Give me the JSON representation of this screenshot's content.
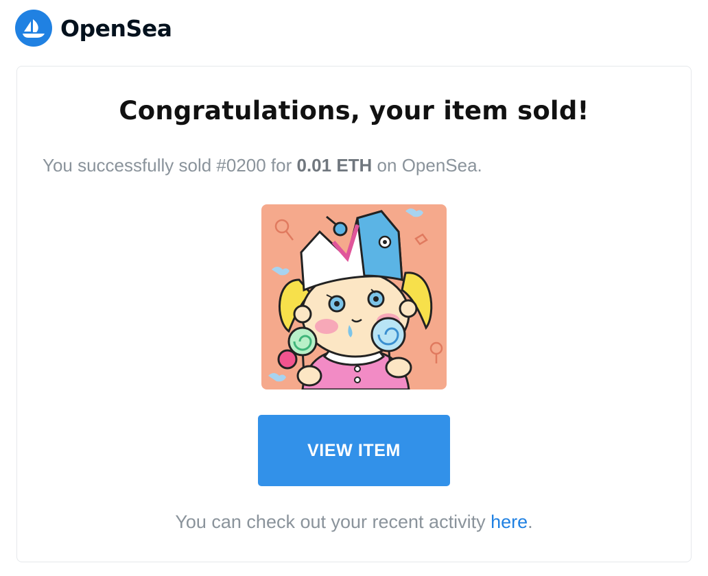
{
  "header": {
    "brand_name": "OpenSea",
    "logo_icon": "opensea-boat-icon",
    "brand_color": "#2081E2"
  },
  "card": {
    "title": "Congratulations, your item sold!",
    "subtitle": {
      "prefix": "You successfully sold #0200 for ",
      "price": "0.01 ETH",
      "suffix": " on OpenSea."
    },
    "nft_image": {
      "icon": "nft-artwork-girl-with-lollipops",
      "background_color": "#F5A98C"
    },
    "button": {
      "label": "VIEW ITEM",
      "color": "#3291E9"
    },
    "footer": {
      "prefix": "You can check out your recent activity ",
      "link_text": "here",
      "suffix": "."
    }
  }
}
